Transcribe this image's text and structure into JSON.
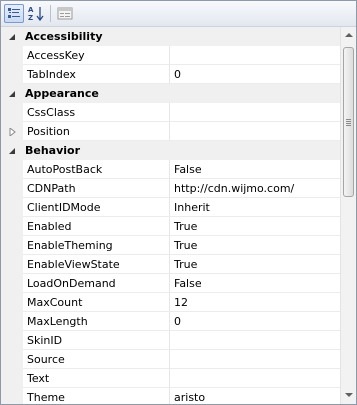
{
  "toolbar": {
    "buttons": [
      {
        "name": "categorized-view-button",
        "icon": "categorized-icon",
        "active": true
      },
      {
        "name": "alphabetical-sort-button",
        "icon": "sort-az-icon",
        "active": false
      },
      {
        "name": "property-pages-button",
        "icon": "property-pages-icon",
        "active": false
      }
    ],
    "sort_glyph": "AZ"
  },
  "grid": {
    "rows": [
      {
        "kind": "category",
        "label": "Accessibility",
        "expanded": true
      },
      {
        "kind": "property",
        "label": "AccessKey",
        "value": ""
      },
      {
        "kind": "property",
        "label": "TabIndex",
        "value": "0"
      },
      {
        "kind": "category",
        "label": "Appearance",
        "expanded": true
      },
      {
        "kind": "property",
        "label": "CssClass",
        "value": ""
      },
      {
        "kind": "property",
        "label": "Position",
        "value": "",
        "expandable": true
      },
      {
        "kind": "category",
        "label": "Behavior",
        "expanded": true
      },
      {
        "kind": "property",
        "label": "AutoPostBack",
        "value": "False"
      },
      {
        "kind": "property",
        "label": "CDNPath",
        "value": "http://cdn.wijmo.com/"
      },
      {
        "kind": "property",
        "label": "ClientIDMode",
        "value": "Inherit"
      },
      {
        "kind": "property",
        "label": "Enabled",
        "value": "True"
      },
      {
        "kind": "property",
        "label": "EnableTheming",
        "value": "True"
      },
      {
        "kind": "property",
        "label": "EnableViewState",
        "value": "True"
      },
      {
        "kind": "property",
        "label": "LoadOnDemand",
        "value": "False"
      },
      {
        "kind": "property",
        "label": "MaxCount",
        "value": "12"
      },
      {
        "kind": "property",
        "label": "MaxLength",
        "value": "0"
      },
      {
        "kind": "property",
        "label": "SkinID",
        "value": ""
      },
      {
        "kind": "property",
        "label": "Source",
        "value": ""
      },
      {
        "kind": "property",
        "label": "Text",
        "value": ""
      },
      {
        "kind": "property",
        "label": "Theme",
        "value": "aristo"
      }
    ]
  },
  "colors": {
    "category_bg": "#f0f0f0",
    "gutter_bg": "#f0f0f0",
    "border": "#8f9aa8"
  }
}
